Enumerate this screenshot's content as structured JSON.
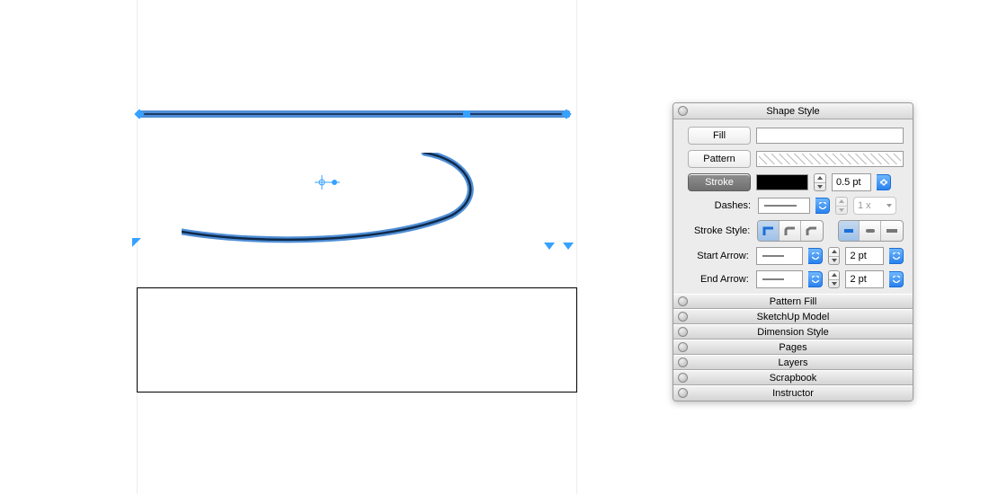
{
  "panel": {
    "title": "Shape Style",
    "fill_label": "Fill",
    "pattern_label": "Pattern",
    "stroke_label": "Stroke",
    "stroke_value": "0.5 pt",
    "dashes_label": "Dashes:",
    "dashes_mult": "1 x",
    "stroke_style_label": "Stroke Style:",
    "start_arrow_label": "Start Arrow:",
    "start_arrow_value": "2 pt",
    "end_arrow_label": "End Arrow:",
    "end_arrow_value": "2 pt",
    "sections": [
      "Pattern Fill",
      "SketchUp Model",
      "Dimension Style",
      "Pages",
      "Layers",
      "Scrapbook",
      "Instructor"
    ]
  }
}
